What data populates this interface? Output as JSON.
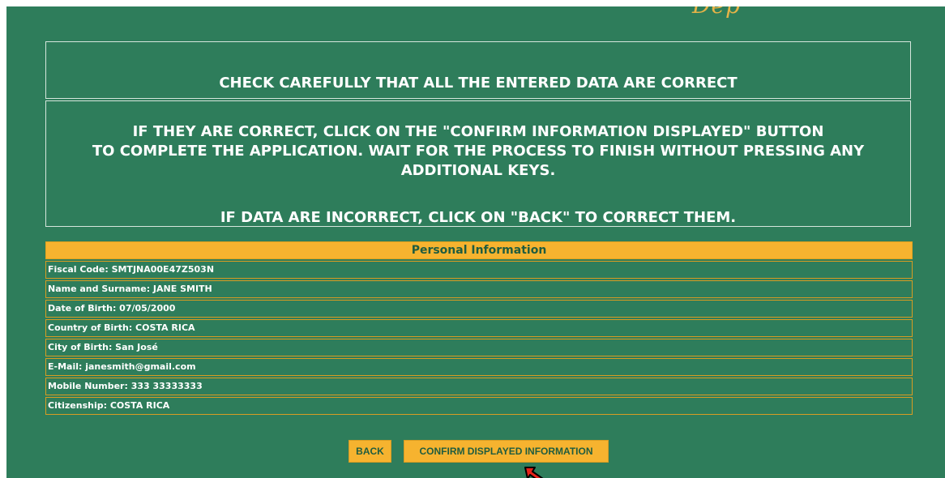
{
  "logo_fragment": "Dep",
  "notice": {
    "check_line": "CHECK CAREFULLY THAT ALL THE ENTERED DATA ARE CORRECT",
    "confirm_line_1": "IF THEY ARE CORRECT, CLICK ON THE \"CONFIRM INFORMATION DISPLAYED\" BUTTON",
    "confirm_line_2": "TO COMPLETE THE APPLICATION. WAIT FOR THE PROCESS TO FINISH WITHOUT PRESSING ANY",
    "confirm_line_3": "ADDITIONAL KEYS.",
    "back_line": "IF DATA ARE INCORRECT, CLICK ON \"BACK\" TO CORRECT THEM."
  },
  "personal_info": {
    "header": "Personal Information",
    "rows": [
      "Fiscal Code: SMTJNA00E47Z503N",
      "Name and Surname: JANE SMITH",
      "Date of Birth: 07/05/2000",
      "Country of Birth: COSTA RICA",
      "City of Birth: San José",
      "E-Mail: janesmith@gmail.com",
      "Mobile Number: 333 33333333",
      "Citizenship: COSTA RICA"
    ]
  },
  "buttons": {
    "back": "BACK",
    "confirm": "CONFIRM DISPLAYED INFORMATION"
  },
  "colors": {
    "background": "#2e7d5b",
    "accent": "#f6b32f",
    "cursor": "#e8231a"
  },
  "icons": {
    "cursor": "mouse-cursor-arrow-icon"
  }
}
